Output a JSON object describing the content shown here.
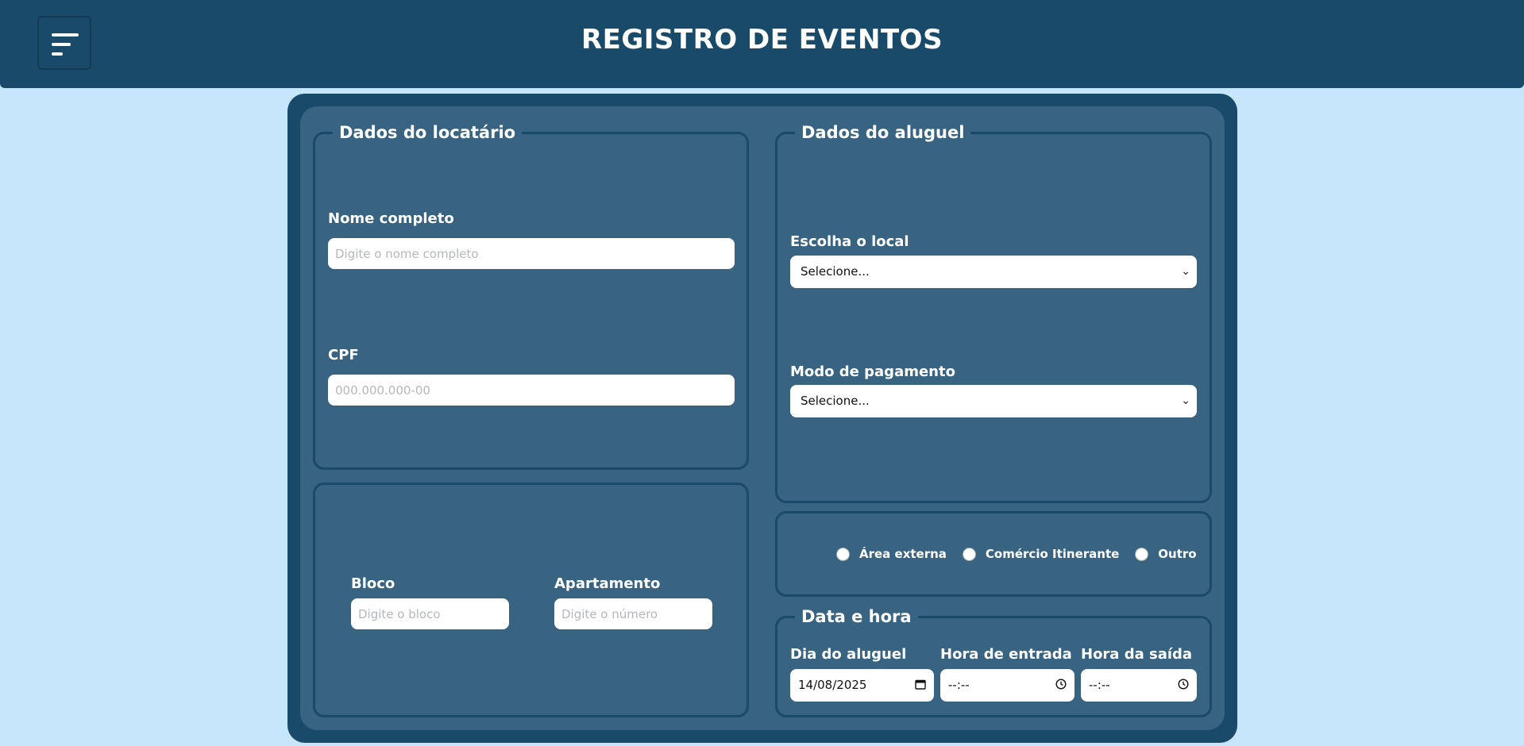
{
  "header": {
    "title": "REGISTRO DE EVENTOS",
    "menu_icon": "hamburger-menu-icon",
    "background": "#1a4a6a"
  },
  "tenant": {
    "legend": "Dados do locatário",
    "name_label": "Nome completo",
    "name_placeholder": "Digite o nome completo",
    "cpf_label": "CPF",
    "cpf_placeholder": "000.000.000-00"
  },
  "residence": {
    "block_label": "Bloco",
    "block_placeholder": "Digite o bloco",
    "apartment_label": "Apartamento",
    "apartment_placeholder": "Digite o número"
  },
  "rental": {
    "legend": "Dados do aluguel",
    "location_label": "Escolha o local",
    "location_value": "Selecione...",
    "payment_label": "Modo de pagamento",
    "payment_value": "Selecione..."
  },
  "event_type": {
    "options": [
      "Área externa",
      "Comércio Itinerante",
      "Outro"
    ]
  },
  "datetime": {
    "legend": "Data e hora",
    "day_label": "Dia do aluguel",
    "day_value": "14/08/2025",
    "entry_label": "Hora de entrada",
    "entry_value": "--:--",
    "exit_label": "Hora da saída",
    "exit_value": "--:--"
  },
  "colors": {
    "page_bg": "#c6e6fb",
    "panel_outer": "#1a4a6a",
    "panel_inner": "#386482",
    "border": "#1b4a69"
  }
}
